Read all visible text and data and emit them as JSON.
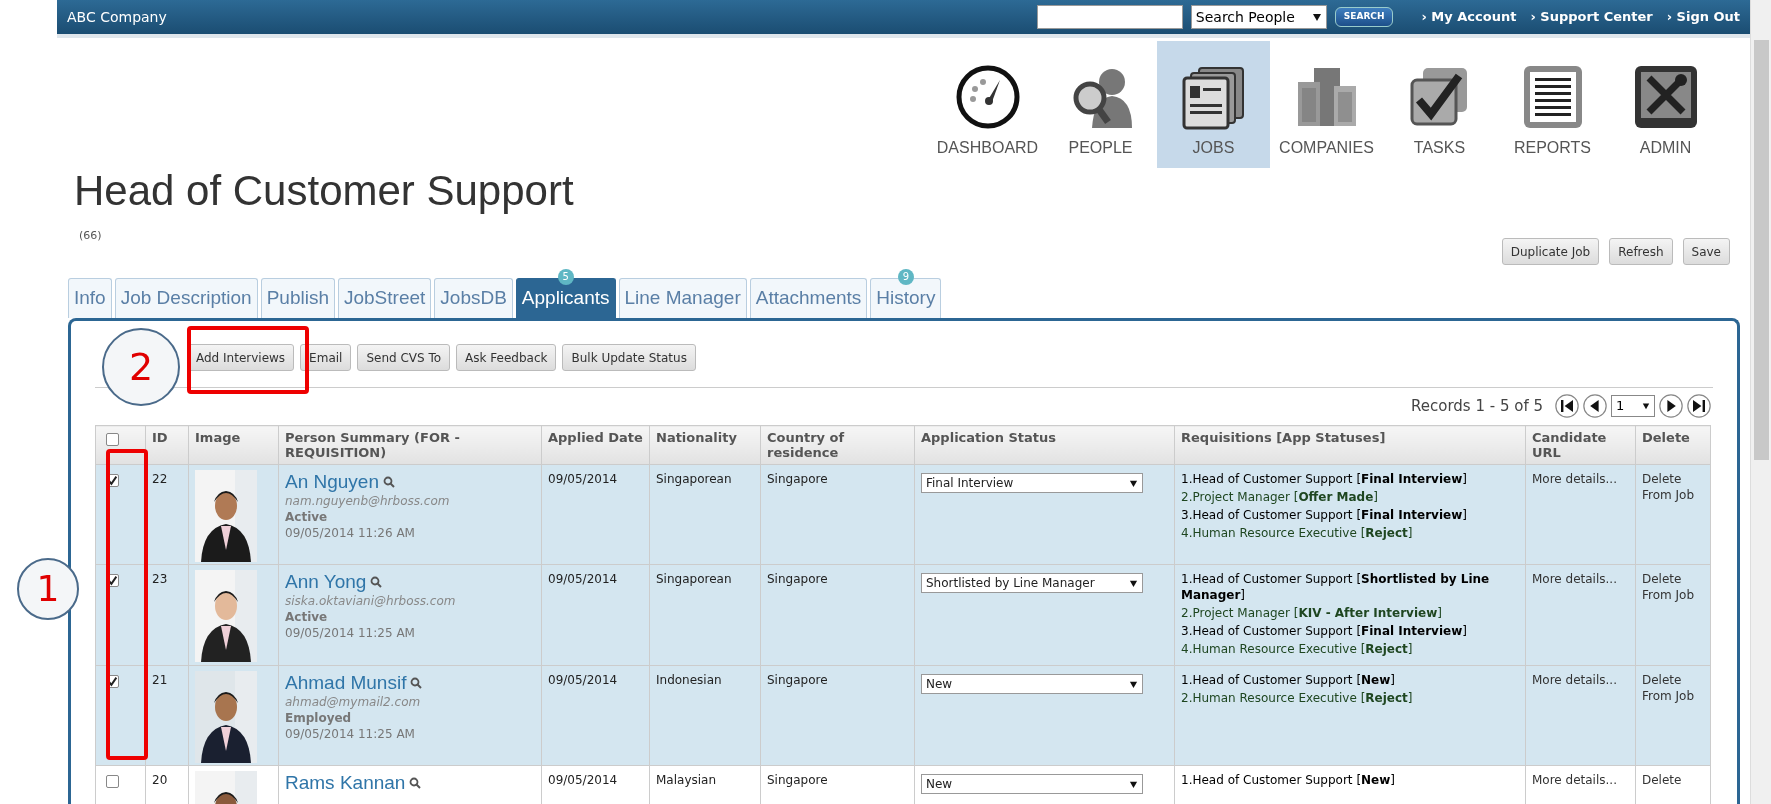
{
  "header": {
    "brand": "ABC Company",
    "search_select": "Search People",
    "search_button": "SEARCH",
    "links": [
      "› My Account",
      "› Support Center",
      "› Sign Out"
    ]
  },
  "nav": [
    {
      "kind": "dashboard",
      "label": "DASHBOARD",
      "selected": false
    },
    {
      "kind": "people",
      "label": "PEOPLE",
      "selected": false
    },
    {
      "kind": "jobs",
      "label": "JOBS",
      "selected": true
    },
    {
      "kind": "companies",
      "label": "COMPANIES",
      "selected": false
    },
    {
      "kind": "tasks",
      "label": "TASKS",
      "selected": false
    },
    {
      "kind": "reports",
      "label": "REPORTS",
      "selected": false
    },
    {
      "kind": "admin",
      "label": "ADMIN",
      "selected": false
    }
  ],
  "title": "Head of Customer Support",
  "count": "(66)",
  "actions": [
    "Duplicate Job",
    "Refresh",
    "Save"
  ],
  "tabs": [
    {
      "label": "Info",
      "selected": false
    },
    {
      "label": "Job Description",
      "selected": false
    },
    {
      "label": "Publish",
      "selected": false
    },
    {
      "label": "JobStreet",
      "selected": false
    },
    {
      "label": "JobsDB",
      "selected": false
    },
    {
      "label": "Applicants",
      "selected": true,
      "badge": "5"
    },
    {
      "label": "Line Manager",
      "selected": false
    },
    {
      "label": "Attachments",
      "selected": false
    },
    {
      "label": "History",
      "selected": false,
      "badge": "9"
    }
  ],
  "toolbar": [
    "Add Interviews",
    "Email",
    "Send CVS To",
    "Ask Feedback",
    "Bulk Update Status"
  ],
  "records": "Records 1 - 5 of 5",
  "page": "1",
  "table": {
    "all_checked": false,
    "columns": [
      "ID",
      "Image",
      "Person Summary (FOR - REQUISITION)",
      "Applied Date",
      "Nationality",
      "Country of residence",
      "Application Status",
      "Requisitions [App Statuses]",
      "Candidate URL",
      "Delete"
    ],
    "rows": [
      {
        "checked": true,
        "id": "22",
        "name": "An Nguyen",
        "email": "nam.nguyenb@hrboss.com",
        "status": "Active",
        "datetime": "09/05/2014 11:26 AM",
        "applied": "09/05/2014",
        "nationality": "Singaporean",
        "country": "Singapore",
        "app_status": "Final Interview",
        "requisitions": [
          {
            "text": "1.Head of Customer Support [**Final Interview**]",
            "color": "#000000"
          },
          {
            "text": "2.Project Manager [**Offer Made**]",
            "color": "#1e4620"
          },
          {
            "text": "3.Head of Customer Support [**Final Interview**]",
            "color": "#000000"
          },
          {
            "text": "4.Human Resource Executive [**Reject**]",
            "color": "#1e4620"
          }
        ],
        "url": "More details...",
        "delete": "Delete From Job"
      },
      {
        "checked": true,
        "id": "23",
        "name": "Ann Yong",
        "email": "siska.oktaviani@hrboss.com",
        "status": "Active",
        "datetime": "09/05/2014 11:25 AM",
        "applied": "09/05/2014",
        "nationality": "Singaporean",
        "country": "Singapore",
        "app_status": "Shortlisted by Line Manager",
        "requisitions": [
          {
            "text": "1.Head of Customer Support [**Shortlisted by Line Manager**]",
            "color": "#000000"
          },
          {
            "text": "2.Project Manager [**KIV - After Interview**]",
            "color": "#1e4620"
          },
          {
            "text": "3.Head of Customer Support [**Final Interview**]",
            "color": "#000000"
          },
          {
            "text": "4.Human Resource Executive [**Reject**]",
            "color": "#1e4620"
          }
        ],
        "url": "More details...",
        "delete": "Delete From Job"
      },
      {
        "checked": true,
        "id": "21",
        "name": "Ahmad Munsif",
        "email": "ahmad@mymail2.com",
        "status": "Employed",
        "datetime": "09/05/2014 11:25 AM",
        "applied": "09/05/2014",
        "nationality": "Indonesian",
        "country": "Singapore",
        "app_status": "New",
        "requisitions": [
          {
            "text": "1.Head of Customer Support [**New**]",
            "color": "#000000"
          },
          {
            "text": "2.Human Resource Executive [**Reject**]",
            "color": "#1e4620"
          }
        ],
        "url": "More details...",
        "delete": "Delete From Job"
      },
      {
        "checked": false,
        "id": "20",
        "name": "Rams Kannan",
        "applied": "09/05/2014",
        "nationality": "Malaysian",
        "country": "Singapore",
        "app_status": "New",
        "requisitions": [
          {
            "text": "1.Head of Customer Support [**New**]",
            "color": "#000000"
          }
        ],
        "url": "More details...",
        "delete": "Delete"
      }
    ]
  },
  "annotations": [
    "1",
    "2"
  ]
}
